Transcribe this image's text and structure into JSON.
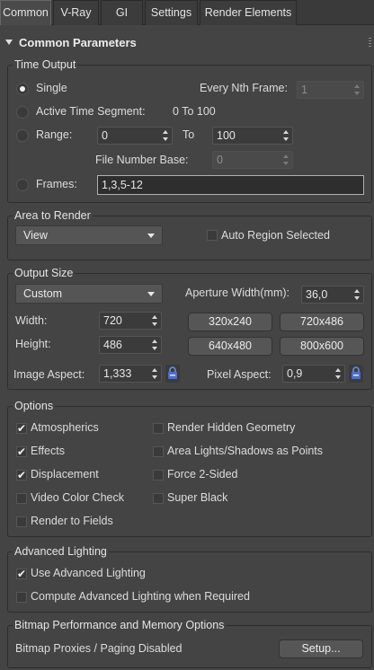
{
  "tabs": [
    "Common",
    "V-Ray",
    "GI",
    "Settings",
    "Render Elements"
  ],
  "rollout_title": "Common Parameters",
  "time_output": {
    "title": "Time Output",
    "single": "Single",
    "every_nth": "Every Nth Frame:",
    "every_nth_value": "1",
    "active_segment": "Active Time Segment:",
    "active_segment_value": "0 To 100",
    "range": "Range:",
    "range_from": "0",
    "range_to_label": "To",
    "range_to": "100",
    "file_number_base": "File Number Base:",
    "file_number_base_value": "0",
    "frames": "Frames:",
    "frames_value": "1,3,5-12"
  },
  "area_to_render": {
    "title": "Area to Render",
    "selected": "View",
    "auto_region": "Auto Region Selected"
  },
  "output_size": {
    "title": "Output Size",
    "preset": "Custom",
    "aperture_label": "Aperture Width(mm):",
    "aperture_value": "36,0",
    "width_label": "Width:",
    "width_value": "720",
    "height_label": "Height:",
    "height_value": "486",
    "presets": [
      "320x240",
      "720x486",
      "640x480",
      "800x600"
    ],
    "image_aspect_label": "Image Aspect:",
    "image_aspect_value": "1,333",
    "pixel_aspect_label": "Pixel Aspect:",
    "pixel_aspect_value": "0,9"
  },
  "options": {
    "title": "Options",
    "left": [
      {
        "label": "Atmospherics",
        "checked": true
      },
      {
        "label": "Effects",
        "checked": true
      },
      {
        "label": "Displacement",
        "checked": true
      },
      {
        "label": "Video Color Check",
        "checked": false
      },
      {
        "label": "Render to Fields",
        "checked": false
      }
    ],
    "right": [
      {
        "label": "Render Hidden Geometry",
        "checked": false
      },
      {
        "label": "Area Lights/Shadows as Points",
        "checked": false
      },
      {
        "label": "Force 2-Sided",
        "checked": false
      },
      {
        "label": "Super Black",
        "checked": false
      }
    ]
  },
  "advanced_lighting": {
    "title": "Advanced Lighting",
    "use": "Use Advanced Lighting",
    "use_checked": true,
    "compute": "Compute Advanced Lighting when Required",
    "compute_checked": false
  },
  "bitmap": {
    "title": "Bitmap Performance and Memory Options",
    "status": "Bitmap Proxies / Paging Disabled",
    "setup": "Setup..."
  }
}
